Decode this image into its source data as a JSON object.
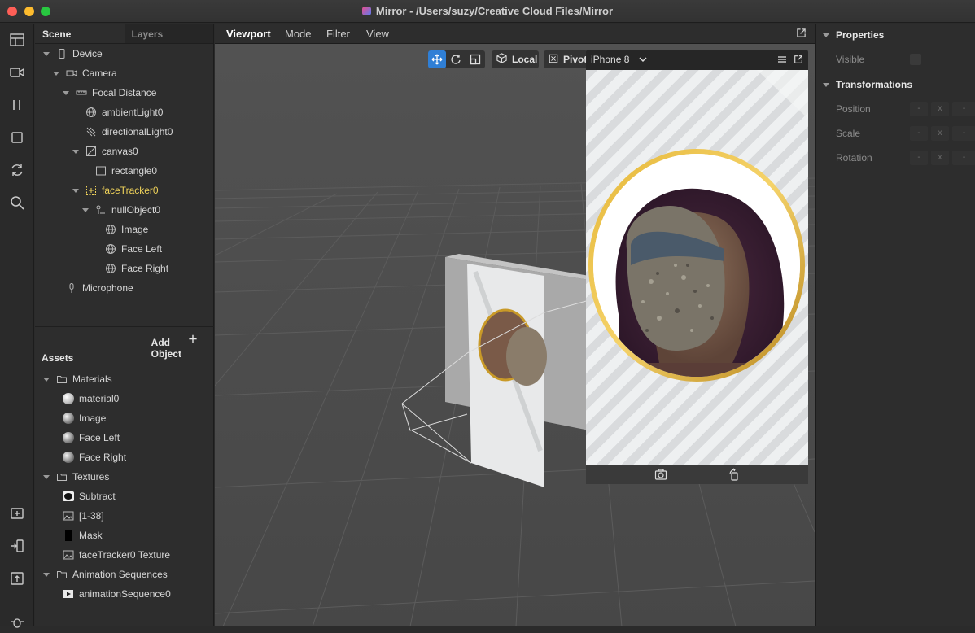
{
  "window": {
    "title": "Mirror - /Users/suzy/Creative Cloud Files/Mirror"
  },
  "scene_panel": {
    "tabs": [
      "Scene",
      "Layers"
    ],
    "tree": [
      {
        "label": "Device"
      },
      {
        "label": "Camera"
      },
      {
        "label": "Focal Distance"
      },
      {
        "label": "ambientLight0"
      },
      {
        "label": "directionalLight0"
      },
      {
        "label": "canvas0"
      },
      {
        "label": "rectangle0"
      },
      {
        "label": "faceTracker0"
      },
      {
        "label": "nullObject0"
      },
      {
        "label": "Image"
      },
      {
        "label": "Face Left"
      },
      {
        "label": "Face Right"
      },
      {
        "label": "Microphone"
      }
    ],
    "add_object_label": "Add Object"
  },
  "assets_panel": {
    "title": "Assets",
    "tree": [
      {
        "label": "Materials"
      },
      {
        "label": "material0"
      },
      {
        "label": "Image"
      },
      {
        "label": "Face Left"
      },
      {
        "label": "Face Right"
      },
      {
        "label": "Textures"
      },
      {
        "label": "Subtract"
      },
      {
        "label": "[1-38]"
      },
      {
        "label": "Mask"
      },
      {
        "label": "faceTracker0 Texture"
      },
      {
        "label": "Animation Sequences"
      },
      {
        "label": "animationSequence0"
      }
    ]
  },
  "viewport": {
    "tabs": [
      "Viewport",
      "Mode",
      "Filter",
      "View"
    ],
    "local_label": "Local",
    "pivot_label": "Pivot",
    "device_label": "iPhone 8"
  },
  "properties_panel": {
    "properties_title": "Properties",
    "visible_label": "Visible",
    "transformations_title": "Transformations",
    "position_label": "Position",
    "scale_label": "Scale",
    "rotation_label": "Rotation",
    "field_placeholder": "-",
    "field_axis": "x"
  },
  "colors": {
    "selected": "#f0d35a",
    "accent_blue": "#2f7fd6"
  }
}
